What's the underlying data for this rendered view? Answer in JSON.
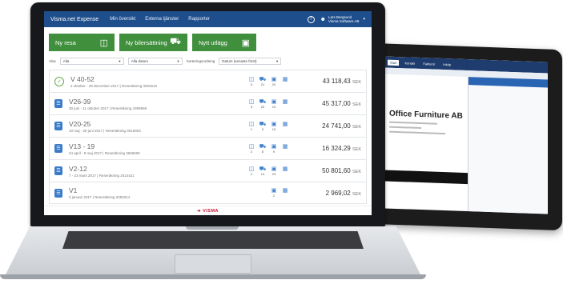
{
  "app": {
    "brand": "Visma.net Expense",
    "menu": [
      "Min översikt",
      "Externa tjänster",
      "Rapporter"
    ],
    "user_name": "Lars Bergsund",
    "user_company": "Visma Software AB"
  },
  "actions": [
    {
      "label": "Ny resa",
      "icon": "document-icon"
    },
    {
      "label": "Ny bilersättning",
      "icon": "car-icon"
    },
    {
      "label": "Nytt utlägg",
      "icon": "wallet-icon"
    }
  ],
  "filters": {
    "view_label": "Visa",
    "view_value": "Alla",
    "date_value": "Alla datum",
    "sort_label": "Sorteringsordning",
    "sort_value": "Datum (senaste först)"
  },
  "reports": [
    {
      "title": "V 40-52",
      "subtitle": "2 oktober - 29 december 2017 | Reseräkning 3002615",
      "status": "done",
      "counts": [
        "5",
        "21",
        "24"
      ],
      "amount": "43 118,43",
      "currency": "SEK"
    },
    {
      "title": "V26-39",
      "subtitle": "30 juni - 11 oktober 2017 | Reseräkning 4399569",
      "status": "report",
      "counts": [
        "5",
        "20",
        "19"
      ],
      "amount": "45 317,00",
      "currency": "SEK"
    },
    {
      "title": "V20-25",
      "subtitle": "10 maj - 28 juni 2017 | Reseräkning 3019003",
      "status": "report",
      "counts": [
        "1",
        "9",
        "15"
      ],
      "amount": "24 741,00",
      "currency": "SEK"
    },
    {
      "title": "V13 - 19",
      "subtitle": "24 april - 9 maj 2017 | Reseräkning 3665606",
      "status": "report",
      "counts": [
        "2",
        "8",
        "9"
      ],
      "amount": "16 324,29",
      "currency": "SEK"
    },
    {
      "title": "V2-12",
      "subtitle": "7 - 23 mars 2017 | Reseräkning 3414421",
      "status": "report",
      "counts": [
        "2",
        "14",
        "23"
      ],
      "amount": "50 801,60",
      "currency": "SEK"
    },
    {
      "title": "V1",
      "subtitle": "3 januari 2017 | Reseräkning 2083314",
      "status": "report",
      "counts": [
        "",
        "",
        "2"
      ],
      "amount": "2 969,02",
      "currency": "SEK"
    }
  ],
  "footer_logo": "VISMA",
  "tablet": {
    "company": "Office Furniture AB",
    "tabs": [
      "Start",
      "Kunder",
      "Fakturor",
      "Inköp"
    ]
  }
}
